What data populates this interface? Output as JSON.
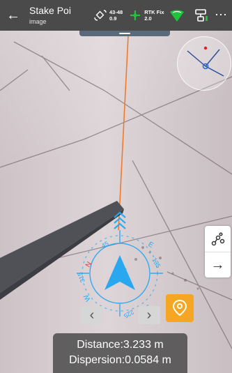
{
  "header": {
    "title": "Stake Poi",
    "subtitle": "image",
    "satellites": "43-48",
    "pdop": "0.9",
    "fix_status": "RTK Fix",
    "age": "2.0",
    "back_icon": "back-arrow-icon",
    "menu_icon": "more-icon"
  },
  "compass": {
    "labels": [
      "N",
      "E",
      "S",
      "W"
    ],
    "degrees": [
      "45",
      "135",
      "225",
      "315"
    ]
  },
  "info": {
    "distance": "Distance:3.233 m",
    "dispersion": "Dispersion:0.0584 m"
  },
  "colors": {
    "topbar": "#4a4a4a",
    "accent_blue": "#29a8f0",
    "stake_line": "#f07a2a",
    "location_button": "#f5a623",
    "fix_green": "#1fc43c"
  }
}
